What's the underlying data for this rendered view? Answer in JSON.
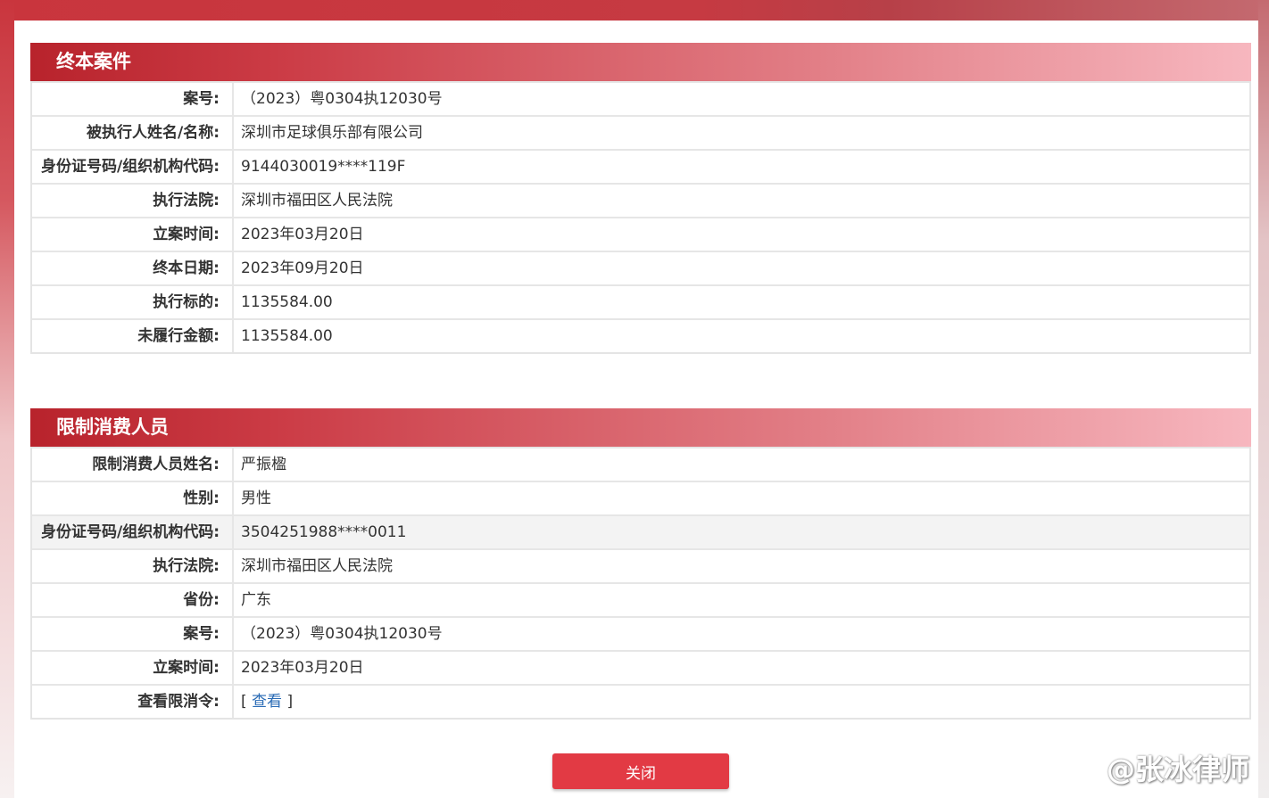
{
  "sections": [
    {
      "title": "终本案件",
      "rows": [
        {
          "label": "案号:",
          "value": "（2023）粤0304执12030号"
        },
        {
          "label": "被执行人姓名/名称:",
          "value": "深圳市足球俱乐部有限公司"
        },
        {
          "label": "身份证号码/组织机构代码:",
          "value": "9144030019****119F"
        },
        {
          "label": "执行法院:",
          "value": "深圳市福田区人民法院"
        },
        {
          "label": "立案时间:",
          "value": "2023年03月20日"
        },
        {
          "label": "终本日期:",
          "value": "2023年09月20日"
        },
        {
          "label": "执行标的:",
          "value": "1135584.00"
        },
        {
          "label": "未履行金额:",
          "value": "1135584.00"
        }
      ]
    },
    {
      "title": "限制消费人员",
      "rows": [
        {
          "label": "限制消费人员姓名:",
          "value": "严振楹"
        },
        {
          "label": "性别:",
          "value": "男性"
        },
        {
          "label": "身份证号码/组织机构代码:",
          "value": "3504251988****0011"
        },
        {
          "label": "执行法院:",
          "value": "深圳市福田区人民法院"
        },
        {
          "label": "省份:",
          "value": "广东"
        },
        {
          "label": "案号:",
          "value": "（2023）粤0304执12030号"
        },
        {
          "label": "立案时间:",
          "value": "2023年03月20日"
        },
        {
          "label": "查看限消令:",
          "value_prefix": "[ ",
          "link_text": "查看",
          "value_suffix": " ]"
        }
      ]
    }
  ],
  "close_button": "关闭",
  "watermark": "@张冰律师",
  "icons": {
    "watermark_icon": "weibo-icon"
  },
  "colors": {
    "accent": "#e23a44",
    "header_start": "#b8232c",
    "header_end": "#f7b7bf",
    "link": "#2a6bb5"
  }
}
